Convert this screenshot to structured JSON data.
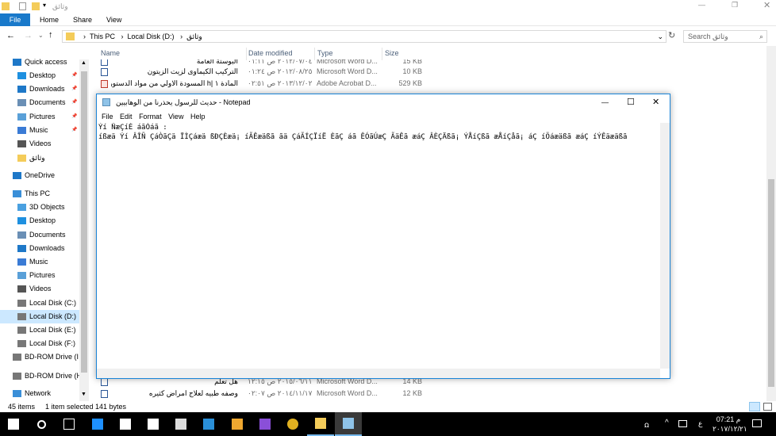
{
  "explorer": {
    "title": "وثائق",
    "ribbon_tabs": [
      "File",
      "Home",
      "Share",
      "View"
    ],
    "breadcrumb": [
      "This PC",
      "Local Disk (D:)",
      "وثائق"
    ],
    "search_placeholder": "Search وثائق",
    "columns": [
      "Name",
      "Date modified",
      "Type",
      "Size"
    ],
    "nav": [
      {
        "label": "Quick access",
        "icon": "star-icon",
        "color": "#1e78c8"
      },
      {
        "label": "Desktop",
        "icon": "desktop-icon",
        "color": "#1e90e0",
        "pin": true
      },
      {
        "label": "Downloads",
        "icon": "download-icon",
        "color": "#1e78c8",
        "pin": true
      },
      {
        "label": "Documents",
        "icon": "documents-icon",
        "color": "#6a8fb5",
        "pin": true
      },
      {
        "label": "Pictures",
        "icon": "pictures-icon",
        "color": "#5aa0d8",
        "pin": true
      },
      {
        "label": "Music",
        "icon": "music-icon",
        "color": "#3a7bd5",
        "pin": true
      },
      {
        "label": "Videos",
        "icon": "videos-icon",
        "color": "#555555"
      },
      {
        "label": "وثائق",
        "icon": "folder-icon",
        "color": "#f4cc5a"
      },
      {
        "label": "OneDrive",
        "icon": "cloud-icon",
        "color": "#1e78c8"
      },
      {
        "label": "This PC",
        "icon": "computer-icon",
        "color": "#3a8fd8"
      },
      {
        "label": "3D Objects",
        "icon": "cube-icon",
        "color": "#4aa0e0"
      },
      {
        "label": "Desktop",
        "icon": "desktop-icon",
        "color": "#1e90e0"
      },
      {
        "label": "Documents",
        "icon": "documents-icon",
        "color": "#6a8fb5"
      },
      {
        "label": "Downloads",
        "icon": "download-icon",
        "color": "#1e78c8"
      },
      {
        "label": "Music",
        "icon": "music-icon",
        "color": "#3a7bd5"
      },
      {
        "label": "Pictures",
        "icon": "pictures-icon",
        "color": "#5aa0d8"
      },
      {
        "label": "Videos",
        "icon": "videos-icon",
        "color": "#555555"
      },
      {
        "label": "Local Disk (C:)",
        "icon": "drive-icon",
        "color": "#777777"
      },
      {
        "label": "Local Disk (D:)",
        "icon": "drive-icon",
        "color": "#777777",
        "selected": true
      },
      {
        "label": "Local Disk (E:)",
        "icon": "drive-icon",
        "color": "#777777"
      },
      {
        "label": "Local Disk (F:)",
        "icon": "drive-icon",
        "color": "#777777"
      },
      {
        "label": "BD-ROM Drive (I",
        "icon": "disc-icon",
        "color": "#777777"
      },
      {
        "label": "BD-ROM Drive (H",
        "icon": "disc-icon",
        "color": "#777777"
      },
      {
        "label": "Network",
        "icon": "network-icon",
        "color": "#3a8fd8"
      }
    ],
    "files_top": [
      {
        "name": "البوستة العامة",
        "date": "٢٠١٢/٠٧/٠٤ ص ٠١:١١",
        "type": "Microsoft Word D...",
        "size": "15 KB",
        "icon": "word-icon"
      },
      {
        "name": "التركيب الكيماوى لزيت الزيتون",
        "date": "٢٠١٢/٠٨/٢٥ ص ٠١:٢٤",
        "type": "Microsoft Word D...",
        "size": "10 KB",
        "icon": "word-icon"
      },
      {
        "name": "المادة ١ |h المسودة الاولي من مواد الدستور...",
        "date": "٢٠١٣/١٢/٠٢ ص ٠٢:٥١",
        "type": "Adobe Acrobat D...",
        "size": "529 KB",
        "icon": "pdf-icon"
      }
    ],
    "files_bottom": [
      {
        "name": "هل تعلم",
        "date": "٢٠١٥/٠٦/١١ ص ١٢:١٥",
        "type": "Microsoft Word D...",
        "size": "14 KB",
        "icon": "word-icon"
      },
      {
        "name": "وصفه طبيه لعلاج امراض كثيره",
        "date": "٢٠١٤/١١/١٧ ص ٠٢:٠٧",
        "type": "Microsoft Word D...",
        "size": "12 KB",
        "icon": "word-icon"
      }
    ],
    "status": {
      "items": "45 items",
      "selected": "1 item selected  141 bytes"
    }
  },
  "notepad": {
    "title": "حديث للرسول يحذرنا من الوهابيين - Notepad",
    "menu": [
      "File",
      "Edit",
      "Format",
      "View",
      "Help"
    ],
    "content": "Ýí ÑæÇíÉ áãÓáã :\níßæä Ýí ÂÎÑ ÇáÒãÇä ÏÌÇáæä ßÐÇÈæä¡ íÃÊæäßã ãä ÇáÃÍÇÏíË ÈãÇ áã ÊÓãÚæÇ ÃäÊã æáÇ ÂÈÇÄßã¡ ÝÅíÇßã æÅíÇåã¡ áÇ íÖáæäßã æáÇ íÝÊäæäßã"
  },
  "taskbar": {
    "apps": [
      "windows-icon",
      "search-icon",
      "task-view-icon",
      "edge-icon",
      "store-icon",
      "mail-icon",
      "media-player-classic-icon",
      "media-player-icon",
      "winamp-icon",
      "visual-studio-icon",
      "chrome-icon",
      "file-explorer-icon",
      "notepad-icon"
    ],
    "time": "07:21 م",
    "date": "٢٠١٧/١٢/٢١",
    "lang": "ع"
  }
}
